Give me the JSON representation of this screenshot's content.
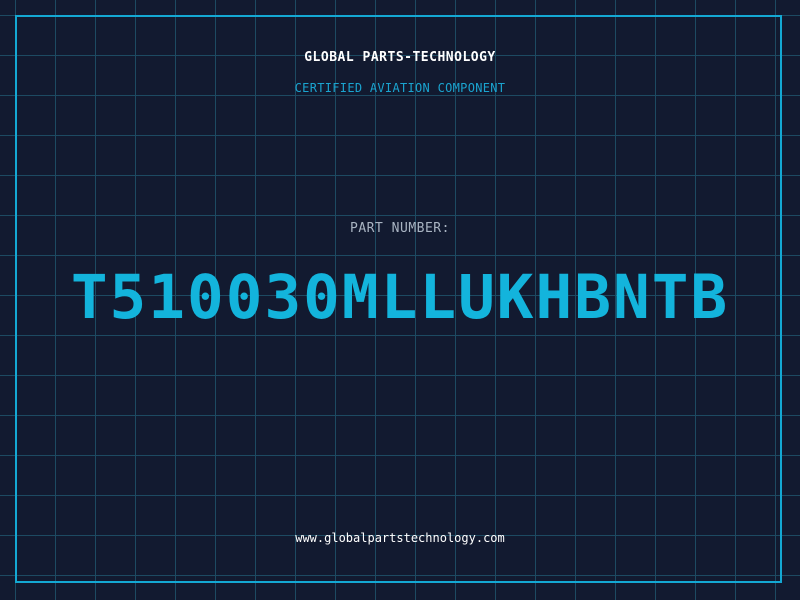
{
  "brand": {
    "name": "GLOBAL PARTS-TECHNOLOGY",
    "tagline": "CERTIFIED AVIATION COMPONENT"
  },
  "part": {
    "label": "PART NUMBER:",
    "number": "T510030MLLUKHBNTB"
  },
  "footer": {
    "website": "www.globalpartstechnology.com"
  },
  "colors": {
    "background": "#121a30",
    "grid": "#1d4a62",
    "accent": "#13b4dc",
    "text": "#ffffff",
    "muted": "#a9b4c2"
  }
}
